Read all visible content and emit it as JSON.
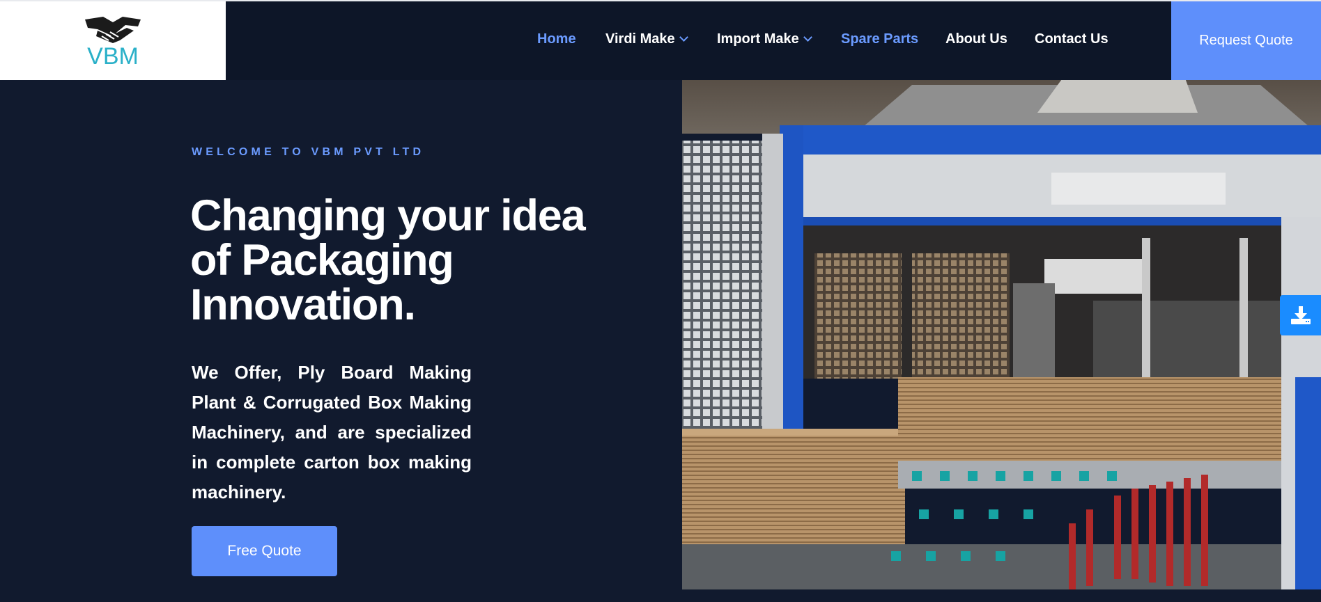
{
  "brand": {
    "logo_text": "VBM"
  },
  "nav": {
    "items": [
      {
        "label": "Home",
        "active": true,
        "has_dropdown": false
      },
      {
        "label": "Virdi Make",
        "active": false,
        "has_dropdown": true
      },
      {
        "label": "Import Make",
        "active": false,
        "has_dropdown": true
      },
      {
        "label": "Spare Parts",
        "active": false,
        "has_dropdown": false
      },
      {
        "label": "About Us",
        "active": false,
        "has_dropdown": false
      },
      {
        "label": "Contact Us",
        "active": false,
        "has_dropdown": false
      }
    ],
    "cta_label": "Request Quote"
  },
  "hero": {
    "eyebrow": "WELCOME TO VBM PVT LTD",
    "headline_line1": "Changing your idea",
    "headline_line2": "of Packaging",
    "headline_line3": "Innovation.",
    "description": "We Offer, Ply Board Making Plant & Corrugated Box Making Machinery, and are specialized in complete carton box making machinery.",
    "button_label": "Free Quote"
  },
  "icons": {
    "download": "download-icon",
    "chevron": "chevron-down-icon"
  },
  "colors": {
    "accent": "#5e8ffb",
    "background": "#111a2e",
    "header": "#0d1628",
    "download_tab": "#1a8cff"
  }
}
